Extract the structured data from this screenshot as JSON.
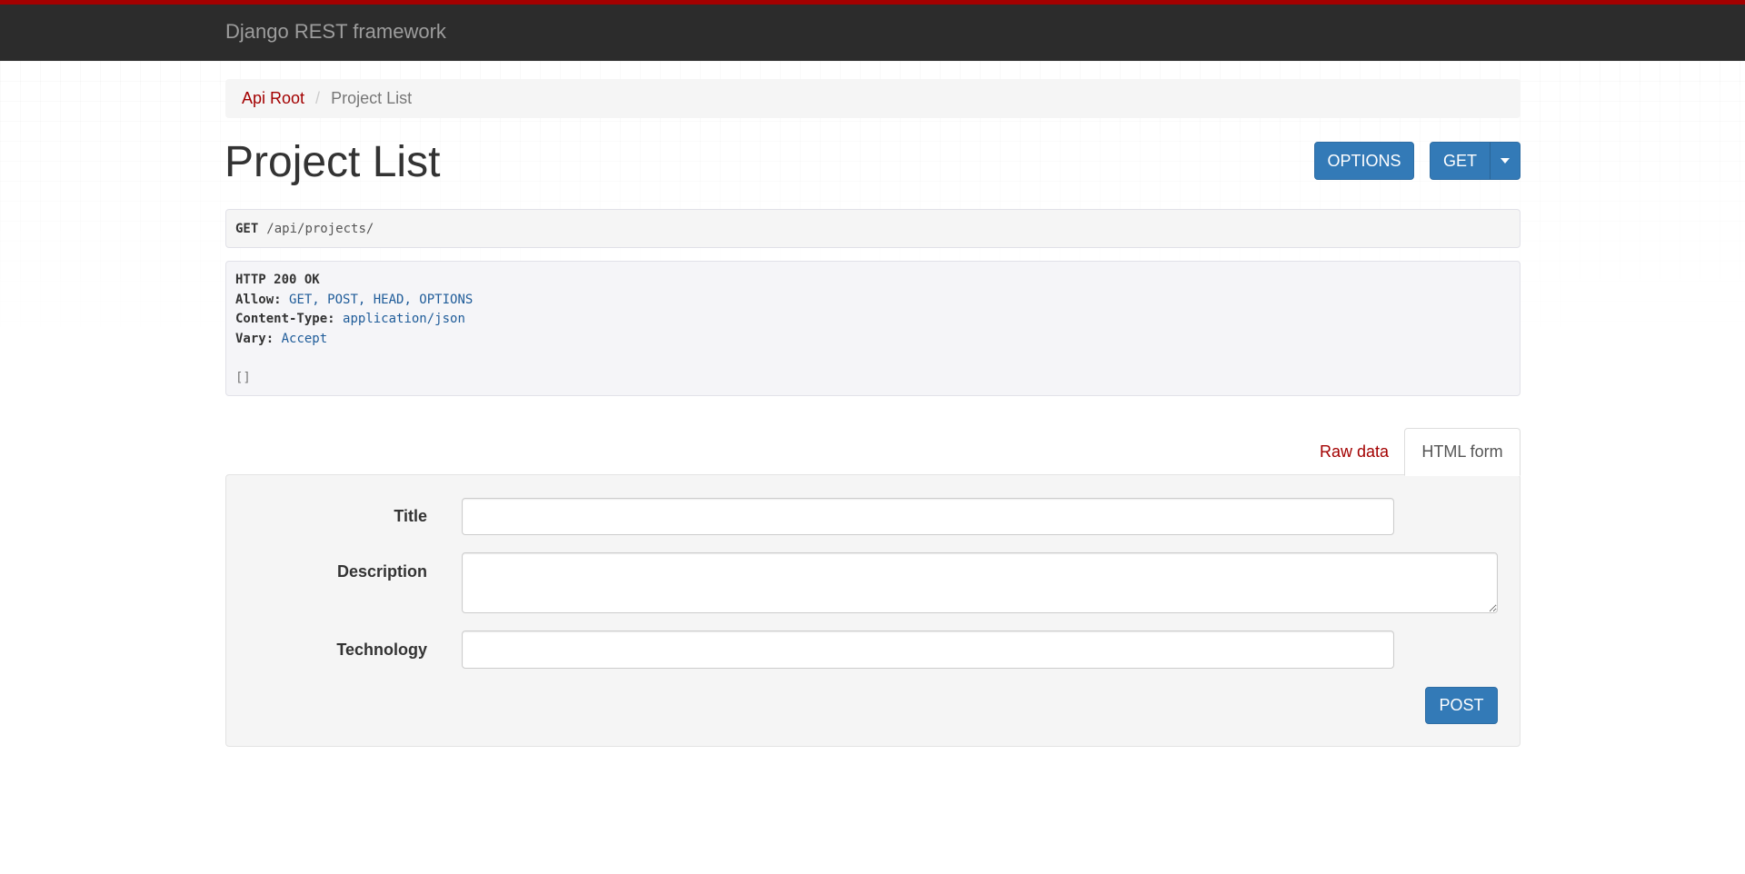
{
  "navbar": {
    "brand": "Django REST framework"
  },
  "breadcrumb": {
    "root_label": "Api Root",
    "separator": "/",
    "current_label": "Project List"
  },
  "page": {
    "title": "Project List"
  },
  "actions": {
    "options_label": "OPTIONS",
    "get_label": "GET"
  },
  "request": {
    "method": "GET",
    "path": "/api/projects/"
  },
  "response": {
    "status_line": "HTTP 200 OK",
    "headers": [
      {
        "key": "Allow:",
        "value": "GET, POST, HEAD, OPTIONS"
      },
      {
        "key": "Content-Type:",
        "value": "application/json"
      },
      {
        "key": "Vary:",
        "value": "Accept"
      }
    ],
    "body": "[]"
  },
  "tabs": {
    "raw_data": "Raw data",
    "html_form": "HTML form",
    "active": "HTML form"
  },
  "form": {
    "fields": [
      {
        "label": "Title",
        "value": ""
      },
      {
        "label": "Description",
        "value": ""
      },
      {
        "label": "Technology",
        "value": ""
      }
    ],
    "submit_label": "POST"
  },
  "colors": {
    "navbar_bg": "#2c2c2c",
    "navbar_accent": "#a30000",
    "link": "#a30000",
    "primary_button": "#337ab7",
    "header_value": "#1f5c99"
  },
  "icons": {
    "get_dropdown": "caret-down-icon"
  }
}
